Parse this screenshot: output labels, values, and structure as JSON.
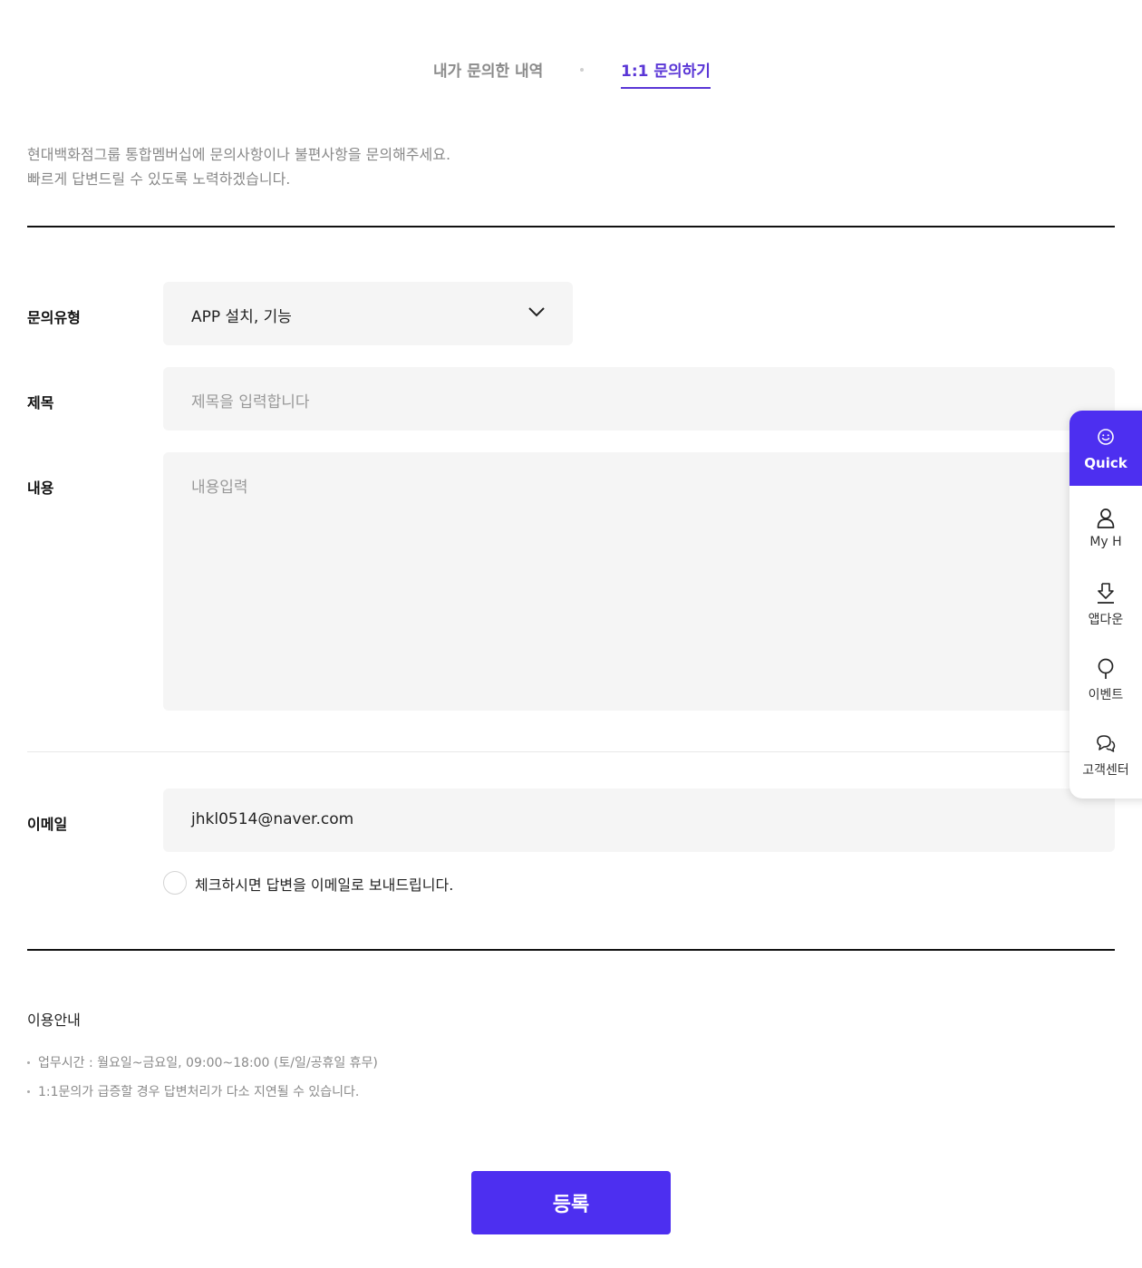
{
  "tabs": {
    "history": "내가 문의한 내역",
    "inquiry": "1:1 문의하기"
  },
  "intro": {
    "line1": "현대백화점그룹 통합멤버십에 문의사항이나 불편사항을 문의해주세요.",
    "line2": "빠르게 답변드릴 수 있도록 노력하겠습니다."
  },
  "form": {
    "type_label": "문의유형",
    "type_value": "APP 설치, 기능",
    "title_label": "제목",
    "title_placeholder": "제목을 입력합니다",
    "content_label": "내용",
    "content_placeholder": "내용입력",
    "email_label": "이메일",
    "email_value": "jhkl0514@naver.com",
    "email_checkbox_label": "체크하시면 답변을 이메일로 보내드립니다.",
    "email_checkbox_checked": false
  },
  "guide": {
    "title": "이용안내",
    "items": [
      "업무시간 : 월요일~금요일, 09:00~18:00 (토/일/공휴일 휴무)",
      "1:1문의가 급증할 경우 답변처리가 다소 지연될 수 있습니다."
    ]
  },
  "submit_label": "등록",
  "quick_menu": {
    "header": "Quick",
    "items": [
      {
        "label": "My H",
        "icon": "person-icon"
      },
      {
        "label": "앱다운",
        "icon": "download-icon"
      },
      {
        "label": "이벤트",
        "icon": "balloon-icon"
      },
      {
        "label": "고객센터",
        "icon": "chat-icon"
      }
    ]
  },
  "colors": {
    "accent": "#4d2ff0",
    "active_tab": "#5a36d6",
    "field_bg": "#f5f5f5"
  }
}
